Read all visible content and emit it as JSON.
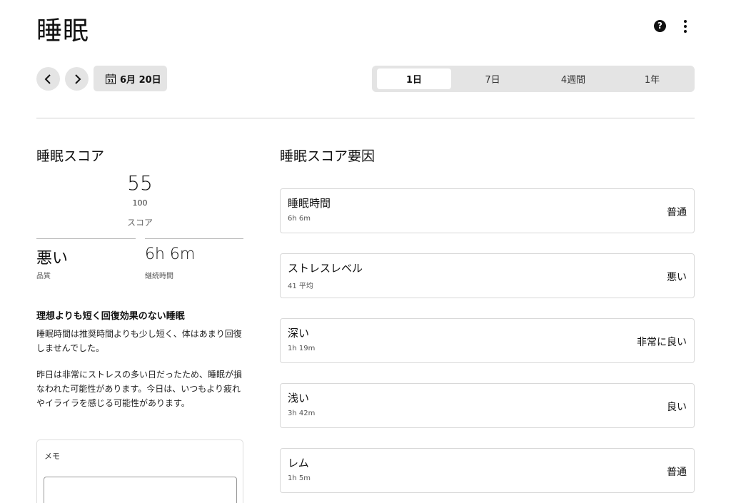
{
  "header": {
    "title": "睡眠",
    "help_icon": "help-icon",
    "more_icon": "more-vertical-icon"
  },
  "toolbar": {
    "prev_icon": "chevron-left-icon",
    "next_icon": "chevron-right-icon",
    "date_label": "6月 20日",
    "calendar_icon_day": "31",
    "range_tabs": [
      {
        "label": "1日",
        "active": true
      },
      {
        "label": "7日",
        "active": false
      },
      {
        "label": "4週間",
        "active": false
      },
      {
        "label": "1年",
        "active": false
      }
    ]
  },
  "score": {
    "title": "睡眠スコア",
    "value": "55",
    "max": "100",
    "caption": "スコア",
    "quality_value": "悪い",
    "quality_label": "品質",
    "duration_value": "6h 6m",
    "duration_label": "継続時間"
  },
  "summary": {
    "heading": "理想よりも短く回復効果のない睡眠",
    "paragraph1": "睡眠時間は推奨時間よりも少し短く、体はあまり回復しませんでした。",
    "paragraph2": "昨日は非常にストレスの多い日だったため、睡眠が損なわれた可能性があります。今日は、いつもより疲れやイライラを感じる可能性があります。"
  },
  "memo": {
    "label": "メモ",
    "value": ""
  },
  "factors": {
    "title": "睡眠スコア要因",
    "items": [
      {
        "name": "睡眠時間",
        "sub": "6h 6m",
        "rating": "普通"
      },
      {
        "name": "ストレスレベル",
        "sub": "41 平均",
        "rating": "悪い"
      },
      {
        "name": "深い",
        "sub": "1h 19m",
        "rating": "非常に良い"
      },
      {
        "name": "浅い",
        "sub": "3h 42m",
        "rating": "良い"
      },
      {
        "name": "レム",
        "sub": "1h 5m",
        "rating": "普通"
      }
    ]
  },
  "colors": {
    "control_bg": "#e4e4e4",
    "border": "#d8d8d8",
    "text": "#111111"
  }
}
